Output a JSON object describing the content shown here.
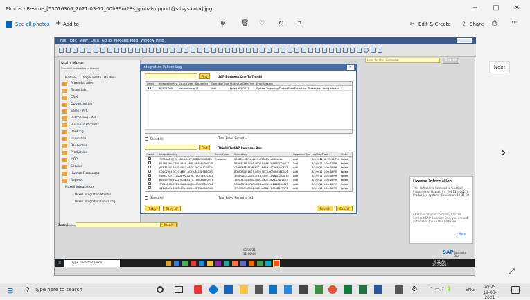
{
  "window": {
    "title": "Photos - Rescue_[55016306_2021-03-17_00h39m28s_globalsupport@sitsys.com].jpg",
    "minimize": "−",
    "maximize": "□",
    "close": "✕"
  },
  "toolbar": {
    "see_all_photos": "See all photos",
    "add_to": "Add to",
    "edit_create": "Edit & Create",
    "share": "Share"
  },
  "viewer": {
    "next_tooltip": "Next"
  },
  "sap": {
    "menu_items": [
      "File",
      "Edit",
      "View",
      "Data",
      "Go To",
      "Modules",
      "Tools",
      "Window",
      "Help"
    ],
    "search_placeholder": "Look for the Guidance",
    "search_btn": "Search",
    "main_menu": {
      "title": "Main Menu",
      "company": "Goodwill Industries of Hawaii",
      "tabs": [
        "Modules",
        "Drag & Relate",
        "My Menu"
      ],
      "items": [
        "Administration",
        "Financials",
        "CRM",
        "Opportunities",
        "Sales - A/R",
        "Purchasing - A/P",
        "Business Partners",
        "Banking",
        "Inventory",
        "Resources",
        "Production",
        "MRP",
        "Service",
        "Human Resources",
        "Reports",
        "Nexell Integration",
        "Nexell Integration Monitor",
        "Nexell Integration Failure Log"
      ]
    },
    "dialog": {
      "title": "Integration Failure Log",
      "find": "Find",
      "sap_to_third_title": "SAP Business One To Thirdd",
      "top_headers": [
        "Select",
        "IntegrationKey",
        "SourceType",
        "SourceKey",
        "OperationType",
        "Status",
        "LogDateTime",
        "ErrorMessage"
      ],
      "top_row": {
        "key": "60578,000",
        "type": "VendorGroup",
        "skey": "16",
        "op": "Add",
        "status": "Failed",
        "date": "6/1/2021",
        "msg": "System.Threading.ThreadAbortException: Thread was being aborted."
      },
      "select_all": "Select All",
      "total_failed_top": "Total Failed Record = 1",
      "third_to_sap_title": "Thirdd To SAP Business One",
      "bottom_headers": [
        "Select",
        "IntegrationKey",
        "SourceType",
        "SourceKey",
        "OperationType",
        "LogDateTime",
        "Status"
      ],
      "bottom_rows": [
        {
          "key": "70F4AA8-0CE8-4AD8-B0EF-D6FDE5D05BE9",
          "type": "Customer",
          "skey": "68402bd-2f3e-4d59-af15-4fcec085ab6c",
          "op": "Add",
          "date": "3/3/2021 12:53:14 PM",
          "st": "Failed"
        },
        {
          "key": "E24B17BA-C35E-4B4B-A65E-BB62F44DAC8B",
          "type": "",
          "skey": "57B85C88-3124-48D3-BDA4-08B87DC05ACD",
          "op": "Add",
          "date": "3/3/2021 1:00:47 PM",
          "st": "Failed"
        },
        {
          "key": "A7B3750A-AEAE-45E0-ABDE-E6C0CA105C08",
          "type": "",
          "skey": "C598F68E-482B-47C1-B81B-4FC4C85ACF07",
          "op": "Add",
          "date": "3/3/2021 1:00:48 PM",
          "st": "Failed"
        },
        {
          "key": "C0D02904-3C2C-4B25-AC70-3C1AF9B60DF8",
          "type": "",
          "skey": "8D0F2B1E-16E7-4409-9EC6-6030BE4FD0DD",
          "op": "Add",
          "date": "3/3/2021 1:00:48 PM",
          "st": "Failed"
        },
        {
          "key": "FA95C7C3-C1D2-4F0C-AE90-1D0F4E52C0B1",
          "type": "",
          "skey": "3B6D3A5A-2035-4F1B-9A9E-1D1B0D2A8C3E",
          "op": "Add",
          "date": "3/3/2021 1:00:48 PM",
          "st": "Failed"
        },
        {
          "key": "B5D55E56-F422-4D8E-B1F1-7490AA6E0257",
          "type": "",
          "skey": "1B0C3E34-E3A0-4A9C-A62E-0F2BA78F1457",
          "op": "Add",
          "date": "3/3/2021 1:00:48 PM",
          "st": "Failed"
        },
        {
          "key": "7FE10D03-E7B9-41BB-A8CF-4A5D7E6A9F86",
          "type": "",
          "skey": "5C6A8D7E-7F0A-4E2B-A4C6-1D2B4E9A3F77",
          "op": "Add",
          "date": "3/3/2021 1:00:48 PM",
          "st": "Failed"
        },
        {
          "key": "A12A3A71-E6CC-4C94-B004-8E7D8A0DF4CE",
          "type": "",
          "skey": "9F0C32E9-E3D4-4A22-AB8B-FEC56D0753F1",
          "op": "Add",
          "date": "3/3/2021 1:00:48 PM",
          "st": "Failed"
        }
      ],
      "total_failed_bottom": "Total Failed Record = 582",
      "retry": "Retry",
      "retry_all": "Retry All",
      "refresh": "Refresh",
      "cancel": "Cancel"
    },
    "bottom_search_label": "Search",
    "bottom_search_btn": "Search",
    "license": {
      "title": "License Information",
      "body": "This software is licensed to Goodwill Industries of Hawaii, Inc. (0815546021) - Production system - Expires on 12-31-99.",
      "attention": "Attention: If your company has not licensed SAP Business One, you are not authorized to use this software.",
      "more": "More",
      "brand": "SAP",
      "brand_sub": "Business One"
    },
    "clock": {
      "time": "9:51 AM",
      "date": "3/17/2021"
    },
    "inner_taskbar_search": "Type here to search",
    "status_values": [
      "05/06/21",
      "11:06AM"
    ]
  },
  "taskbar": {
    "search_placeholder": "Type here to search",
    "lang": "ENG",
    "time": "20:25",
    "date": "19-03-2021"
  },
  "colors": {
    "sap_blue": "#4a6ea3",
    "accent": "#0067c0",
    "yellow_field": "#ffffc0",
    "find_button": "#ffd54a"
  }
}
